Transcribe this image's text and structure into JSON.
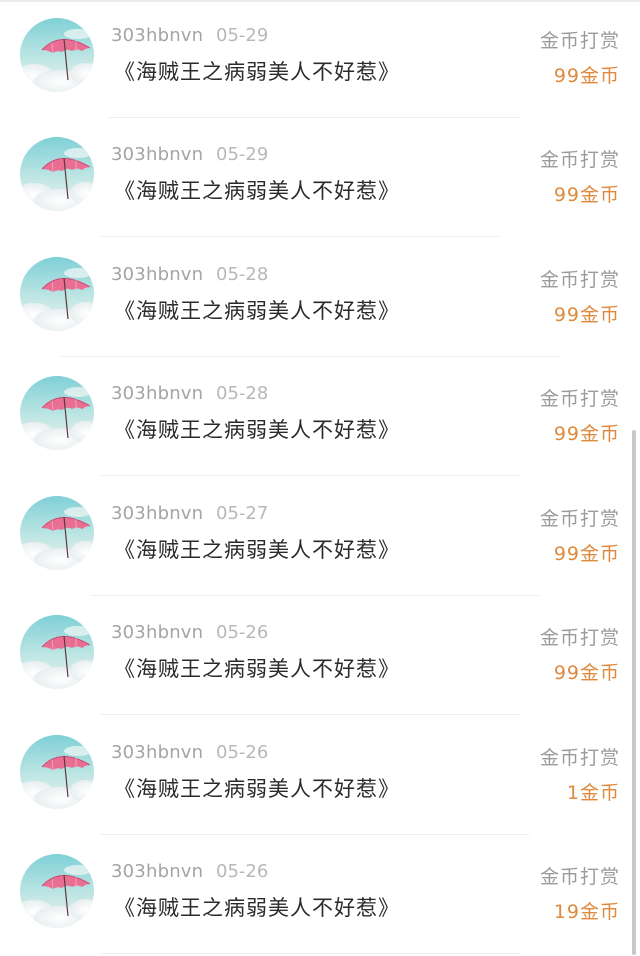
{
  "colors": {
    "username": "#a4a4a4",
    "date": "#b8b8b8",
    "title": "#2b2b2b",
    "reward_type": "#9b9b9b",
    "reward_amount": "#e0883c"
  },
  "rewards": [
    {
      "avatar_icon": "umbrella-sky-icon",
      "username": "303hbnvn",
      "date": "05-29",
      "title": "《海贼王之病弱美人不好惹》",
      "reward_type": "金币打赏",
      "amount": "99金币"
    },
    {
      "avatar_icon": "umbrella-sky-icon",
      "username": "303hbnvn",
      "date": "05-29",
      "title": "《海贼王之病弱美人不好惹》",
      "reward_type": "金币打赏",
      "amount": "99金币"
    },
    {
      "avatar_icon": "umbrella-sky-icon",
      "username": "303hbnvn",
      "date": "05-28",
      "title": "《海贼王之病弱美人不好惹》",
      "reward_type": "金币打赏",
      "amount": "99金币"
    },
    {
      "avatar_icon": "umbrella-sky-icon",
      "username": "303hbnvn",
      "date": "05-28",
      "title": "《海贼王之病弱美人不好惹》",
      "reward_type": "金币打赏",
      "amount": "99金币"
    },
    {
      "avatar_icon": "umbrella-sky-icon",
      "username": "303hbnvn",
      "date": "05-27",
      "title": "《海贼王之病弱美人不好惹》",
      "reward_type": "金币打赏",
      "amount": "99金币"
    },
    {
      "avatar_icon": "umbrella-sky-icon",
      "username": "303hbnvn",
      "date": "05-26",
      "title": "《海贼王之病弱美人不好惹》",
      "reward_type": "金币打赏",
      "amount": "99金币"
    },
    {
      "avatar_icon": "umbrella-sky-icon",
      "username": "303hbnvn",
      "date": "05-26",
      "title": "《海贼王之病弱美人不好惹》",
      "reward_type": "金币打赏",
      "amount": "1金币"
    },
    {
      "avatar_icon": "umbrella-sky-icon",
      "username": "303hbnvn",
      "date": "05-26",
      "title": "《海贼王之病弱美人不好惹》",
      "reward_type": "金币打赏",
      "amount": "19金币"
    }
  ]
}
